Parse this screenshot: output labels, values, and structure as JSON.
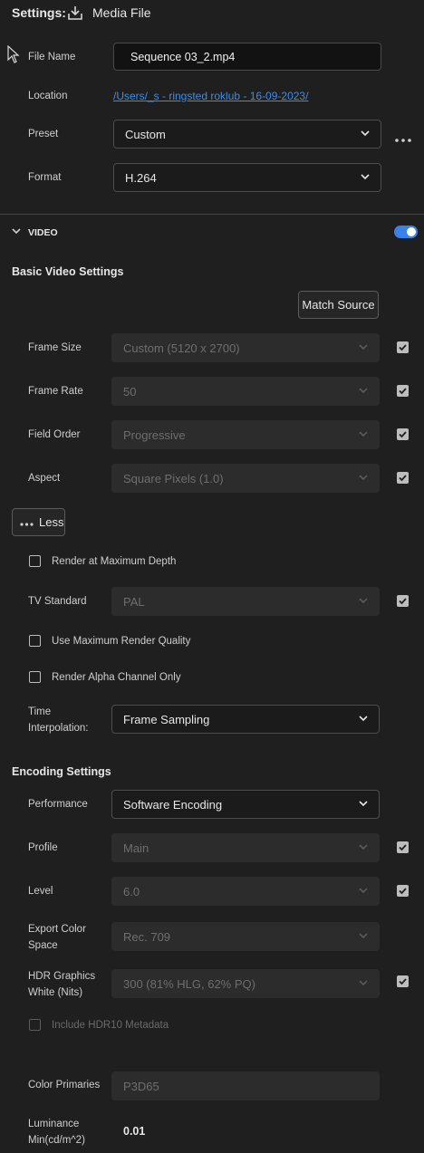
{
  "header": {
    "settings_label": "Settings:",
    "media_file_label": "Media File"
  },
  "file": {
    "file_name_label": "File Name",
    "file_name_value": "Sequence 03_2.mp4",
    "location_label": "Location",
    "location_value": "/Users/_s - ringsted roklub - 16-09-2023/",
    "preset_label": "Preset",
    "preset_value": "Custom",
    "format_label": "Format",
    "format_value": "H.264"
  },
  "video": {
    "section_label": "VIDEO",
    "toggle_on": true,
    "basic_title": "Basic Video Settings",
    "match_source": "Match Source",
    "frame_size_label": "Frame Size",
    "frame_size_value": "Custom (5120 x 2700)",
    "frame_rate_label": "Frame Rate",
    "frame_rate_value": "50",
    "field_order_label": "Field Order",
    "field_order_value": "Progressive",
    "aspect_label": "Aspect",
    "aspect_value": "Square Pixels (1.0)",
    "less_label": "Less",
    "render_max_depth": "Render at Maximum Depth",
    "tv_standard_label": "TV Standard",
    "tv_standard_value": "PAL",
    "use_max_quality": "Use Maximum Render Quality",
    "render_alpha": "Render Alpha Channel Only",
    "time_interp_line1": "Time",
    "time_interp_line2": "Interpolation:",
    "time_interp_value": "Frame Sampling"
  },
  "encoding": {
    "title": "Encoding Settings",
    "performance_label": "Performance",
    "performance_value": "Software Encoding",
    "profile_label": "Profile",
    "profile_value": "Main",
    "level_label": "Level",
    "level_value": "6.0",
    "export_color_line1": "Export Color",
    "export_color_line2": "Space",
    "export_color_value": "Rec. 709",
    "hdr_line1": "HDR Graphics",
    "hdr_line2": "White (Nits)",
    "hdr_value": "300 (81% HLG, 62% PQ)",
    "include_hdr10": "Include HDR10 Metadata",
    "color_primaries_label": "Color Primaries",
    "color_primaries_value": "P3D65",
    "luminance_line1": "Luminance",
    "luminance_line2": "Min(cd/m^2)",
    "luminance_value": "0.01"
  },
  "colors": {
    "accent": "#3b82e8",
    "link": "#3b8de8",
    "background": "#1f1f1f"
  }
}
